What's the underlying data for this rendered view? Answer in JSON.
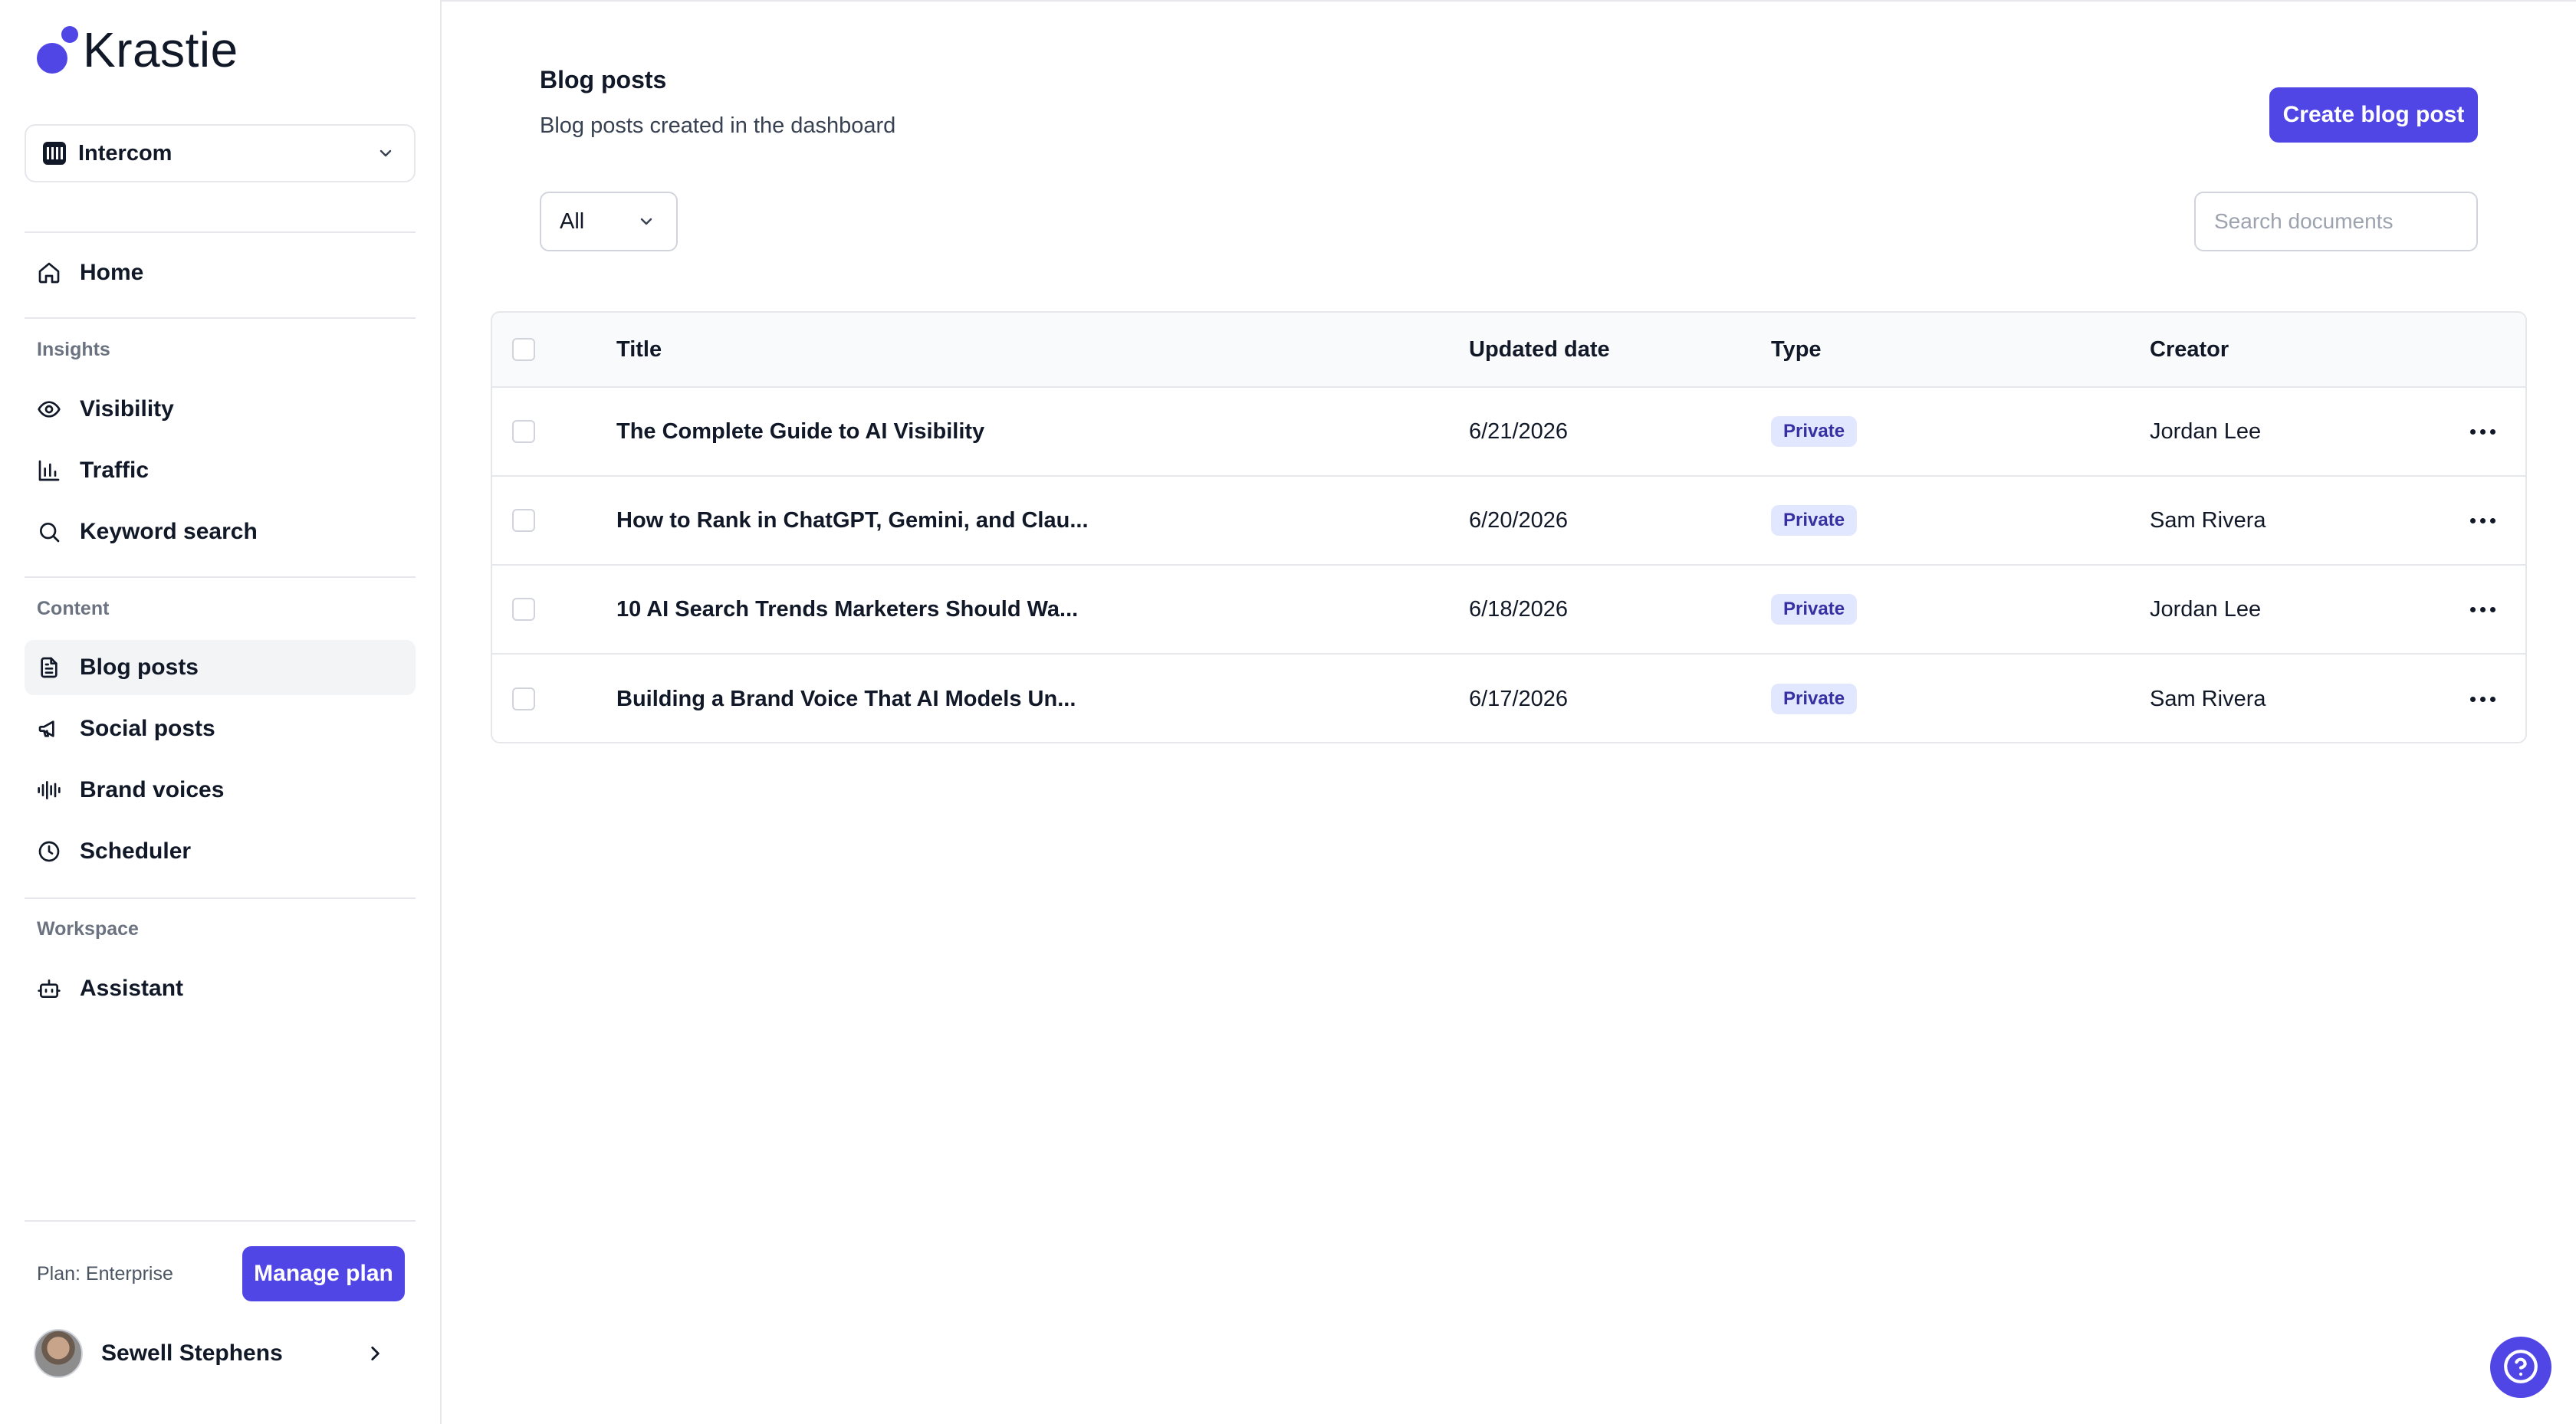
{
  "app": {
    "name": "Krastie"
  },
  "workspace": {
    "selected": "Intercom"
  },
  "sidebar": {
    "home": "Home",
    "sections": {
      "insights": "Insights",
      "content": "Content",
      "workspace": "Workspace"
    },
    "items": [
      {
        "label": "Visibility",
        "icon": "eye-icon"
      },
      {
        "label": "Traffic",
        "icon": "bar-chart-icon"
      },
      {
        "label": "Keyword search",
        "icon": "search-icon"
      },
      {
        "label": "Blog posts",
        "icon": "document-icon",
        "active": true
      },
      {
        "label": "Social posts",
        "icon": "megaphone-icon"
      },
      {
        "label": "Brand voices",
        "icon": "audio-waveform-icon"
      },
      {
        "label": "Scheduler",
        "icon": "clock-icon"
      },
      {
        "label": "Assistant",
        "icon": "bot-icon"
      }
    ],
    "plan_label": "Plan: Enterprise",
    "manage_plan": "Manage plan",
    "user_name": "Sewell Stephens"
  },
  "page": {
    "title": "Blog posts",
    "subtitle": "Blog posts created in the dashboard",
    "create_button": "Create blog post",
    "filter_value": "All",
    "search_placeholder": "Search documents"
  },
  "table": {
    "headers": {
      "title": "Title",
      "updated": "Updated date",
      "type": "Type",
      "creator": "Creator"
    },
    "rows": [
      {
        "title": "The Complete Guide to AI Visibility",
        "date": "6/21/2026",
        "type": "Private",
        "creator": "Jordan Lee"
      },
      {
        "title": "How to Rank in ChatGPT, Gemini, and Clau...",
        "date": "6/20/2026",
        "type": "Private",
        "creator": "Sam Rivera"
      },
      {
        "title": "10 AI Search Trends Marketers Should Wa...",
        "date": "6/18/2026",
        "type": "Private",
        "creator": "Jordan Lee"
      },
      {
        "title": "Building a Brand Voice That AI Models Un...",
        "date": "6/17/2026",
        "type": "Private",
        "creator": "Sam Rivera"
      }
    ]
  },
  "colors": {
    "accent": "#4f46e5",
    "badge_bg": "#e0e7ff",
    "badge_text": "#3730a3"
  }
}
